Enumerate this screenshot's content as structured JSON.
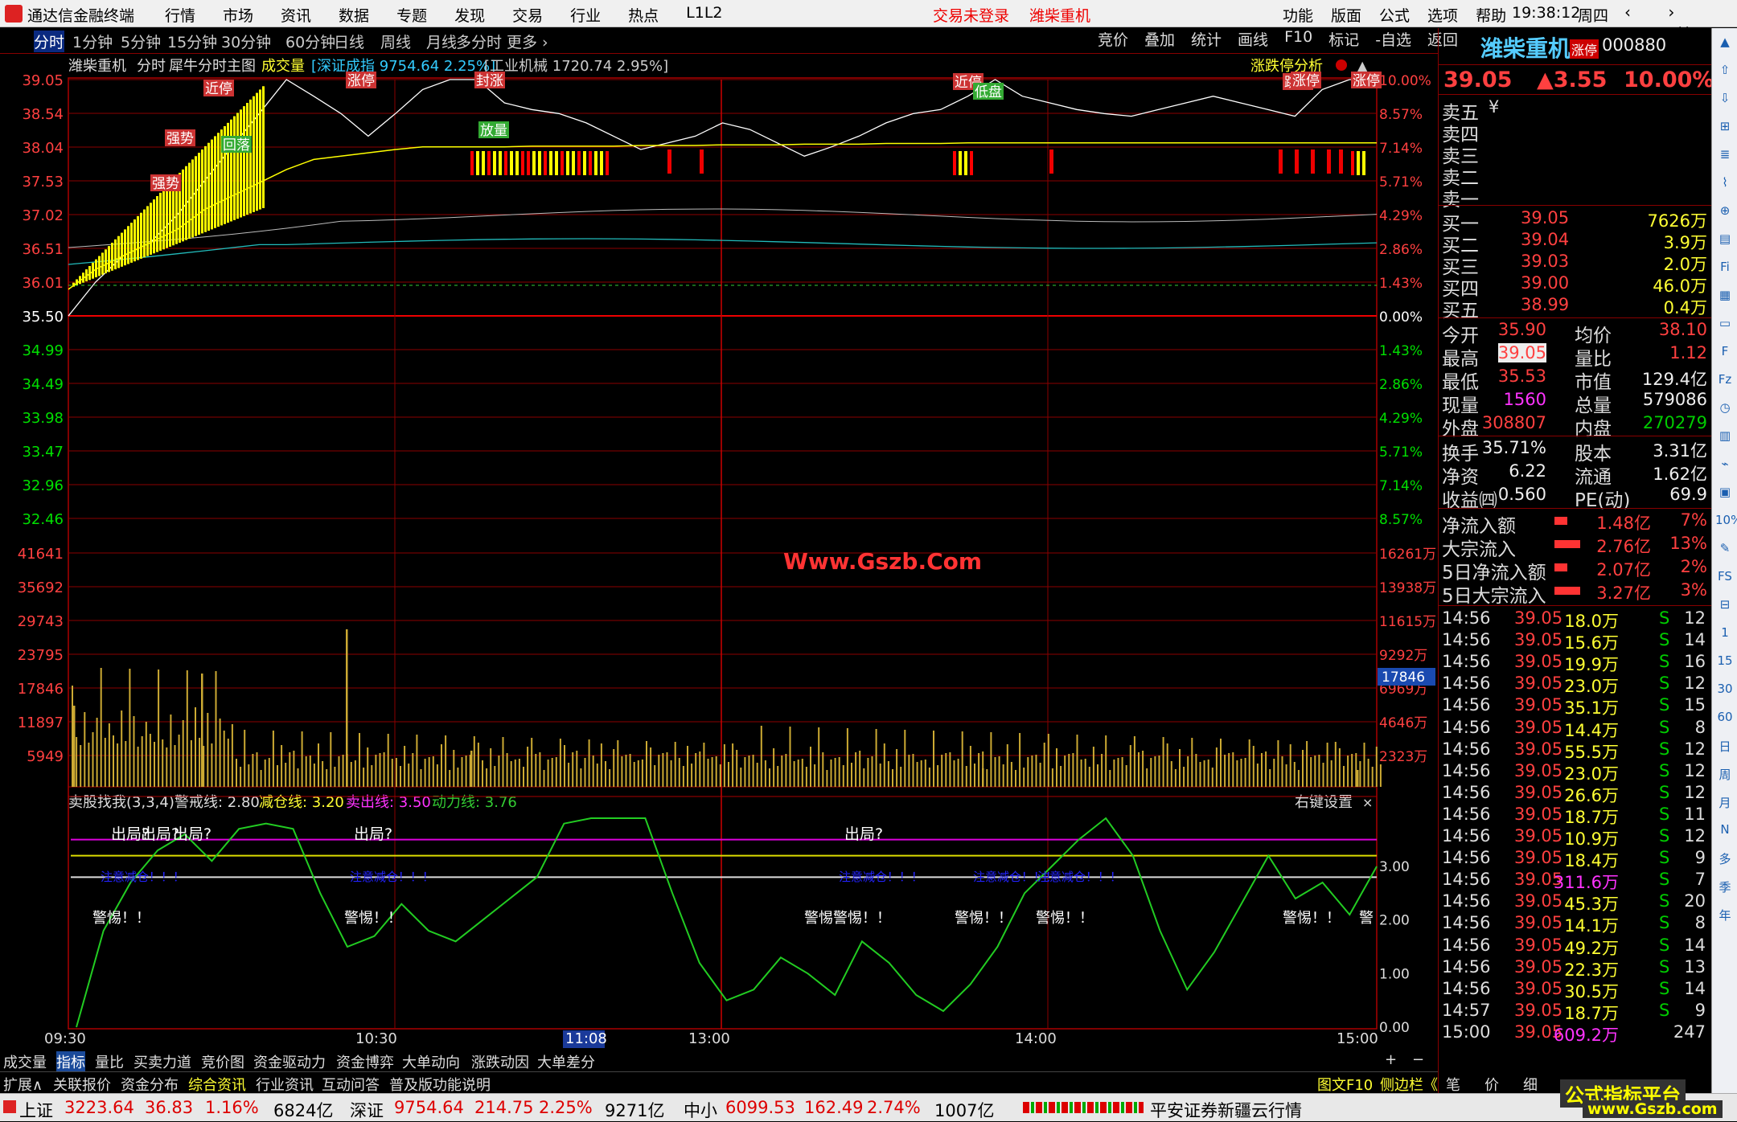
{
  "app": {
    "title": "通达信金融终端",
    "menu": [
      "行情",
      "市场",
      "资讯",
      "数据",
      "专题",
      "发现",
      "交易",
      "行业",
      "热点",
      "L1L2"
    ],
    "notice": "交易未登录",
    "stock_name": "潍柴重机",
    "right_menu": [
      "功能",
      "版面",
      "公式",
      "选项",
      "帮助"
    ],
    "clock": "19:38:12",
    "weekday": "周四",
    "win_controls": "‹ › ▭ ✕"
  },
  "toolbar": {
    "periods": [
      "分时",
      "1分钟",
      "5分钟",
      "15分钟",
      "30分钟",
      "60分钟",
      "日线",
      "周线",
      "月线",
      "多分时",
      "更多 ›"
    ],
    "right": [
      "竞价",
      "叠加",
      "统计",
      "画线",
      "F10",
      "标记",
      "-自选",
      "返回"
    ]
  },
  "chart": {
    "header": {
      "name": "潍柴重机",
      "mode": "分时",
      "indicator": "犀牛分时主图",
      "vol_label": "成交量",
      "index_text": "[深证成指 9754.64 2.25%]",
      "sector_text": "[工业机械 1720.74 2.95%]",
      "zdt": "涨跌停分析"
    },
    "price_left": [
      "39.05",
      "38.54",
      "38.04",
      "37.53",
      "37.02",
      "36.51",
      "36.01",
      "35.50",
      "34.99",
      "34.49",
      "33.98",
      "33.47",
      "32.96",
      "32.46"
    ],
    "pct_right": [
      "10.00%",
      "8.57%",
      "7.14%",
      "5.71%",
      "4.29%",
      "2.86%",
      "1.43%",
      "0.00%",
      "1.43%",
      "2.86%",
      "4.29%",
      "5.71%",
      "7.14%",
      "8.57%"
    ],
    "vol_left": [
      "41641",
      "35692",
      "29743",
      "23795",
      "17846",
      "11897",
      "5949"
    ],
    "vol_right": [
      "16261万",
      "13938万",
      "11615万",
      "9292万",
      "6969万",
      "4646万",
      "2323万"
    ],
    "vol_cursor": "17846",
    "watermark": "Www.Gszb.Com",
    "tags": [
      "涨停",
      "封涨",
      "近停",
      "强势",
      "回落",
      "放量",
      "涨停",
      "近停",
      "低盘",
      "跳高",
      "涨停",
      "涨停",
      "强势"
    ],
    "ind_header": {
      "name": "卖股找我(3,3,4)",
      "l1": "警戒线: 2.80",
      "l2": "减仓线: 3.20",
      "l3": "卖出线: 3.50",
      "l4": "动力线: 3.76",
      "settings": "右键设置"
    },
    "ind_right": [
      "3.00",
      "2.00",
      "1.00",
      "0.00"
    ],
    "sig_out": [
      "出局?",
      "出局?",
      "出局?",
      "出局?",
      "出局?"
    ],
    "sig_warn": [
      "警惕！！",
      "警惕！！",
      "警惕警惕！！",
      "警惕！！",
      "警惕！！",
      "警惕！！",
      "警"
    ],
    "sig_reduce": "注意减仓！！！",
    "time_axis": [
      "09:30",
      "10:30",
      "11:08",
      "13:00",
      "14:00",
      "15:00"
    ],
    "price_series": [
      35.5,
      36.01,
      36.4,
      36.6,
      37.02,
      37.53,
      38.04,
      38.54,
      39.05,
      38.8,
      38.54,
      38.2,
      38.54,
      38.9,
      39.05,
      39.05,
      38.7,
      38.6,
      38.54,
      38.4,
      38.2,
      38.0,
      38.1,
      38.2,
      38.4,
      38.3,
      38.1,
      37.9,
      38.04,
      38.2,
      38.4,
      38.54,
      38.6,
      38.8,
      39.05,
      38.8,
      38.7,
      38.6,
      38.54,
      38.5,
      38.6,
      38.7,
      38.8,
      38.7,
      38.6,
      38.5,
      38.9,
      39.05,
      39.05
    ],
    "avg_series": [
      35.9,
      36.2,
      36.4,
      36.6,
      36.8,
      37.1,
      37.3,
      37.5,
      37.7,
      37.85,
      37.9,
      37.95,
      38.0,
      38.04,
      38.04,
      38.04,
      38.04,
      38.05,
      38.05,
      38.05,
      38.05,
      38.06,
      38.06,
      38.06,
      38.07,
      38.07,
      38.07,
      38.08,
      38.08,
      38.08,
      38.09,
      38.09,
      38.09,
      38.1,
      38.1,
      38.1,
      38.1,
      38.1,
      38.1,
      38.1,
      38.1,
      38.1,
      38.1,
      38.1,
      38.1,
      38.1,
      38.1,
      38.1,
      38.1
    ],
    "ind_series": [
      0.0,
      1.8,
      2.7,
      3.3,
      3.6,
      3.1,
      3.7,
      3.8,
      3.7,
      2.5,
      1.5,
      1.7,
      2.3,
      1.8,
      1.6,
      2.0,
      2.4,
      2.8,
      3.8,
      3.9,
      3.9,
      3.9,
      2.5,
      1.2,
      0.5,
      0.7,
      1.3,
      1.0,
      0.6,
      1.6,
      1.2,
      0.6,
      0.3,
      0.8,
      1.5,
      2.5,
      3.0,
      3.5,
      3.9,
      3.2,
      1.8,
      0.7,
      1.4,
      2.3,
      3.2,
      2.4,
      2.7,
      2.1,
      3.0
    ]
  },
  "panel": {
    "name": "潍柴重机",
    "tag": "涨停",
    "code": "000880",
    "price": "39.05",
    "change": "▲3.55",
    "pct": "10.00%",
    "sell": [
      {
        "l": "卖五",
        "p": "",
        "v": "¥"
      },
      {
        "l": "卖四",
        "p": "",
        "v": ""
      },
      {
        "l": "卖三",
        "p": "",
        "v": ""
      },
      {
        "l": "卖二",
        "p": "",
        "v": ""
      },
      {
        "l": "卖一",
        "p": "",
        "v": ""
      }
    ],
    "buy": [
      {
        "l": "买一",
        "p": "39.05",
        "v": "7626万"
      },
      {
        "l": "买二",
        "p": "39.04",
        "v": "3.9万"
      },
      {
        "l": "买三",
        "p": "39.03",
        "v": "2.0万"
      },
      {
        "l": "买四",
        "p": "39.00",
        "v": "46.0万"
      },
      {
        "l": "买五",
        "p": "38.99",
        "v": "0.4万"
      }
    ],
    "stats1": [
      {
        "a": "今开",
        "b": "35.90",
        "c": "均价",
        "d": "38.10"
      },
      {
        "a": "最高",
        "b": "39.05",
        "c": "量比",
        "d": "1.12"
      },
      {
        "a": "最低",
        "b": "35.53",
        "c": "市值",
        "d": "129.4亿"
      },
      {
        "a": "现量",
        "b": "1560",
        "c": "总量",
        "d": "579086"
      },
      {
        "a": "外盘",
        "b": "308807",
        "c": "内盘",
        "d": "270279"
      }
    ],
    "stats2": [
      {
        "a": "换手",
        "b": "35.71%",
        "c": "股本",
        "d": "3.31亿"
      },
      {
        "a": "净资",
        "b": "6.22",
        "c": "流通",
        "d": "1.62亿"
      },
      {
        "a": "收益㈣",
        "b": "0.560",
        "c": "PE(动)",
        "d": "69.9"
      }
    ],
    "flow": [
      {
        "a": "净流入额",
        "b": "1.48亿",
        "c": "7%"
      },
      {
        "a": "大宗流入",
        "b": "2.76亿",
        "c": "13%"
      },
      {
        "a": "5日净流入额",
        "b": "2.07亿",
        "c": "2%"
      },
      {
        "a": "5日大宗流入",
        "b": "3.27亿",
        "c": "3%"
      }
    ],
    "ticks": [
      [
        "14:56",
        "39.05",
        "18.0万",
        "S",
        "12"
      ],
      [
        "14:56",
        "39.05",
        "15.6万",
        "S",
        "14"
      ],
      [
        "14:56",
        "39.05",
        "19.9万",
        "S",
        "16"
      ],
      [
        "14:56",
        "39.05",
        "23.0万",
        "S",
        "12"
      ],
      [
        "14:56",
        "39.05",
        "35.1万",
        "S",
        "15"
      ],
      [
        "14:56",
        "39.05",
        "14.4万",
        "S",
        "8"
      ],
      [
        "14:56",
        "39.05",
        "55.5万",
        "S",
        "12"
      ],
      [
        "14:56",
        "39.05",
        "23.0万",
        "S",
        "12"
      ],
      [
        "14:56",
        "39.05",
        "26.6万",
        "S",
        "12"
      ],
      [
        "14:56",
        "39.05",
        "18.7万",
        "S",
        "11"
      ],
      [
        "14:56",
        "39.05",
        "10.9万",
        "S",
        "12"
      ],
      [
        "14:56",
        "39.05",
        "18.4万",
        "S",
        "9"
      ],
      [
        "14:56",
        "39.05",
        "311.6万",
        "S",
        "7"
      ],
      [
        "14:56",
        "39.05",
        "45.3万",
        "S",
        "20"
      ],
      [
        "14:56",
        "39.05",
        "14.1万",
        "S",
        "8"
      ],
      [
        "14:56",
        "39.05",
        "49.2万",
        "S",
        "14"
      ],
      [
        "14:56",
        "39.05",
        "22.3万",
        "S",
        "13"
      ],
      [
        "14:56",
        "39.05",
        "30.5万",
        "S",
        "14"
      ],
      [
        "14:57",
        "39.05",
        "18.7万",
        "S",
        "9"
      ],
      [
        "15:00",
        "39.05",
        "609.2万",
        "",
        "247"
      ]
    ]
  },
  "bottom": {
    "tabs": [
      "成交量",
      "指标",
      "量比",
      "买卖力道",
      "竞价图",
      "资金驱动力",
      "资金博弈",
      "大单动向",
      "涨跌动因",
      "大单差分"
    ],
    "tabs2": [
      "扩展∧",
      "关联报价",
      "资金分布",
      "综合资讯",
      "行业资讯",
      "互动问答",
      "普及版功能说明"
    ],
    "tw": "图文F10",
    "sb": "侧边栏《",
    "pn": [
      "笔",
      "价",
      "细"
    ]
  },
  "status": {
    "sh": "上证",
    "sh_v": "3223.64",
    "sh_c": "36.83",
    "sh_p": "1.16%",
    "sh_a": "6824亿",
    "sz": "深证",
    "sz_v": "9754.64",
    "sz_c": "214.75",
    "sz_p": "2.25%",
    "sz_a": "9271亿",
    "zx": "中小",
    "zx_v": "6099.53",
    "zx_c": "162.49",
    "zx_p": "2.74%",
    "zx_a": "1007亿",
    "broker": "平安证券新疆云行情"
  },
  "wm": {
    "a": "公式指标平台",
    "b": "www.Gszb.com"
  },
  "sidebar": [
    "▲",
    "⇧",
    "⇩",
    "⊞",
    "≣",
    "⌇",
    "⊕",
    "▤",
    "Fi",
    "▦",
    "▭",
    "F",
    "Fz",
    "◷",
    "▥",
    "⌁",
    "▣",
    "10%",
    "✎",
    "FS",
    "⊟",
    "1",
    "15",
    "30",
    "60",
    "日",
    "周",
    "月",
    "N",
    "多",
    "季",
    "年"
  ],
  "colors": {
    "up": "#ff4040",
    "down": "#00e000",
    "grid": "#8b0000",
    "axis": "#ff3030",
    "price": "#ffffff",
    "avg": "#ffff00"
  }
}
